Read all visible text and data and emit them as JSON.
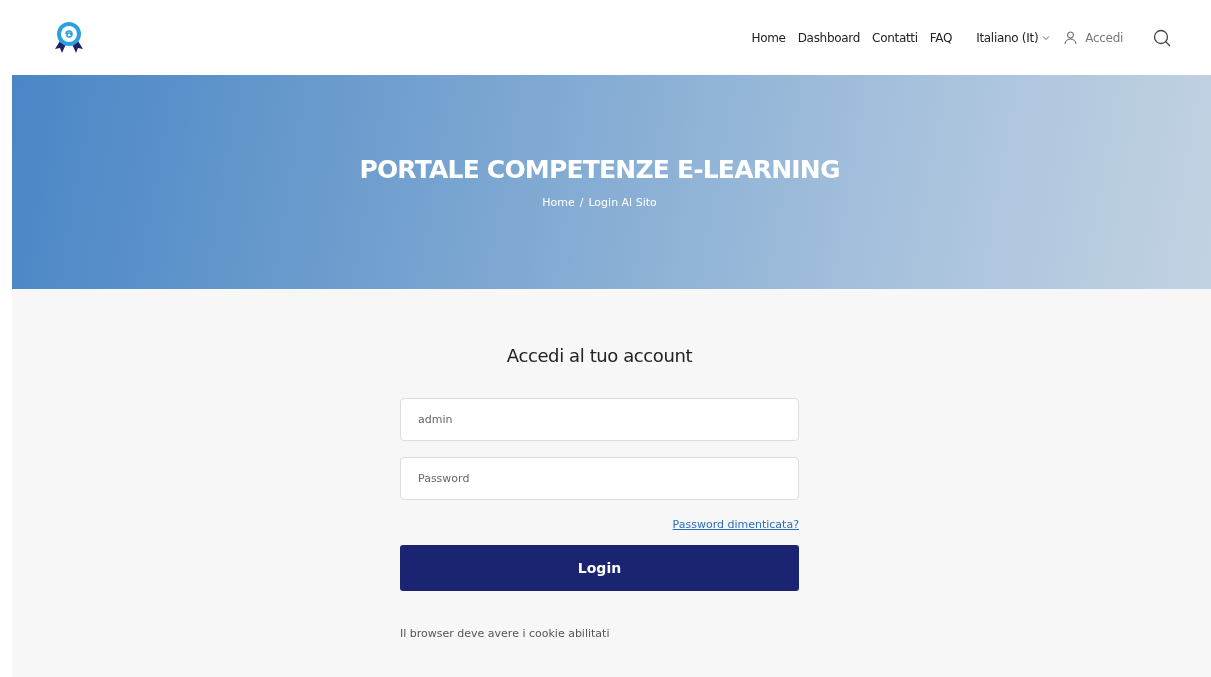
{
  "nav": {
    "links": [
      "Home",
      "Dashboard",
      "Contatti",
      "FAQ"
    ],
    "language": "Italiano (It)",
    "login": "Accedi"
  },
  "hero": {
    "title": "PORTALE COMPETENZE E-LEARNING",
    "breadcrumb": [
      "Home",
      "Login Al Sito"
    ],
    "separator": "/"
  },
  "form": {
    "title": "Accedi al tuo account",
    "username": {
      "value": "admin"
    },
    "password": {
      "placeholder": "Password"
    },
    "forgot": "Password dimenticata?",
    "submit": "Login",
    "note": "Il browser deve avere i cookie abilitati"
  }
}
